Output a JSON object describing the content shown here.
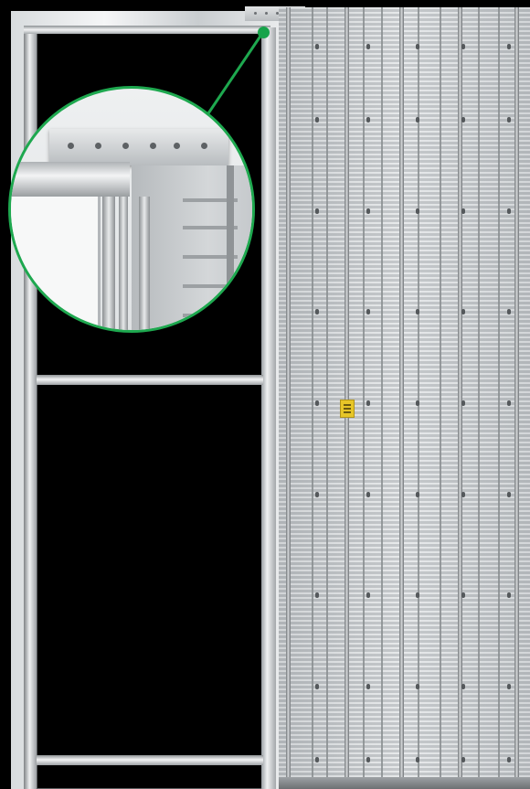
{
  "scene": {
    "subject": "pocket-door-frame",
    "accent_color": "#1ea84f",
    "sticker_color": "#e7c627"
  }
}
